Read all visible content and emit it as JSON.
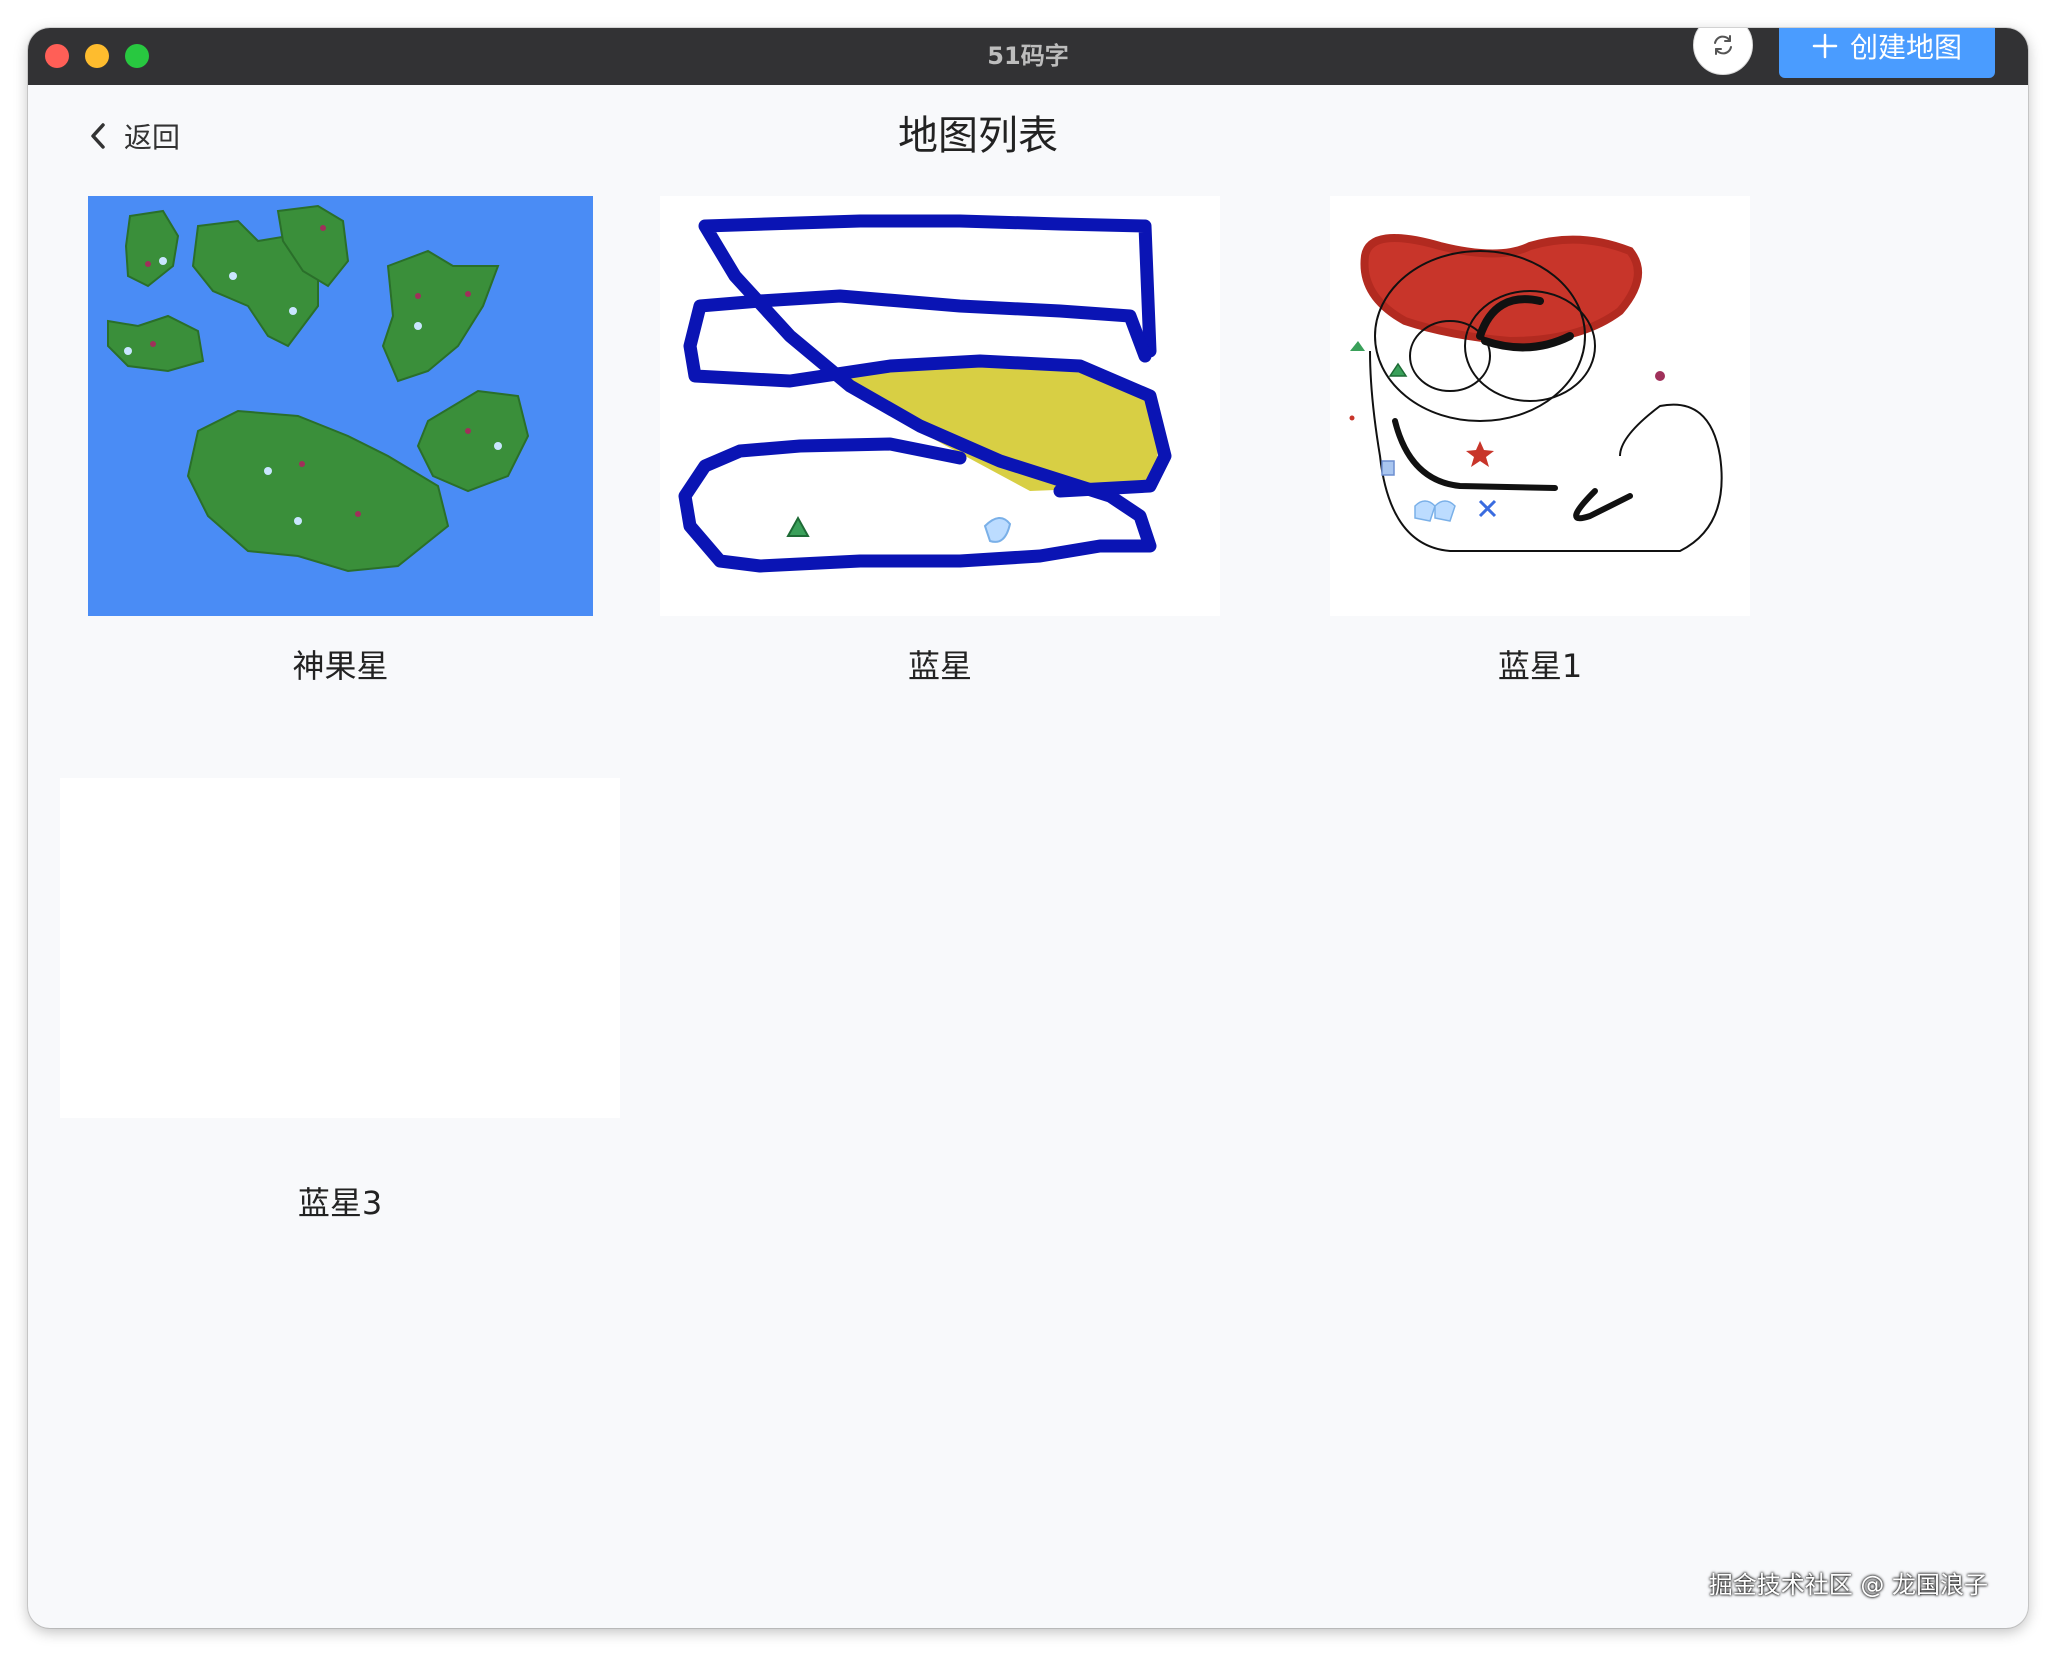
{
  "app": {
    "title": "51码字"
  },
  "header": {
    "back_label": "返回",
    "page_title": "地图列表",
    "create_label": "创建地图"
  },
  "maps": [
    {
      "name": "神果星"
    },
    {
      "name": "蓝星"
    },
    {
      "name": "蓝星1"
    },
    {
      "name": "蓝星3"
    }
  ],
  "colors": {
    "accent": "#4a9cff",
    "ocean": "#4a8cf5",
    "land": "#3a8f3a",
    "stroke_blue": "#0a14b4",
    "fill_yellow": "#d8cf44",
    "red": "#c8352a"
  },
  "watermark": "掘金技术社区 @ 龙国浪子"
}
